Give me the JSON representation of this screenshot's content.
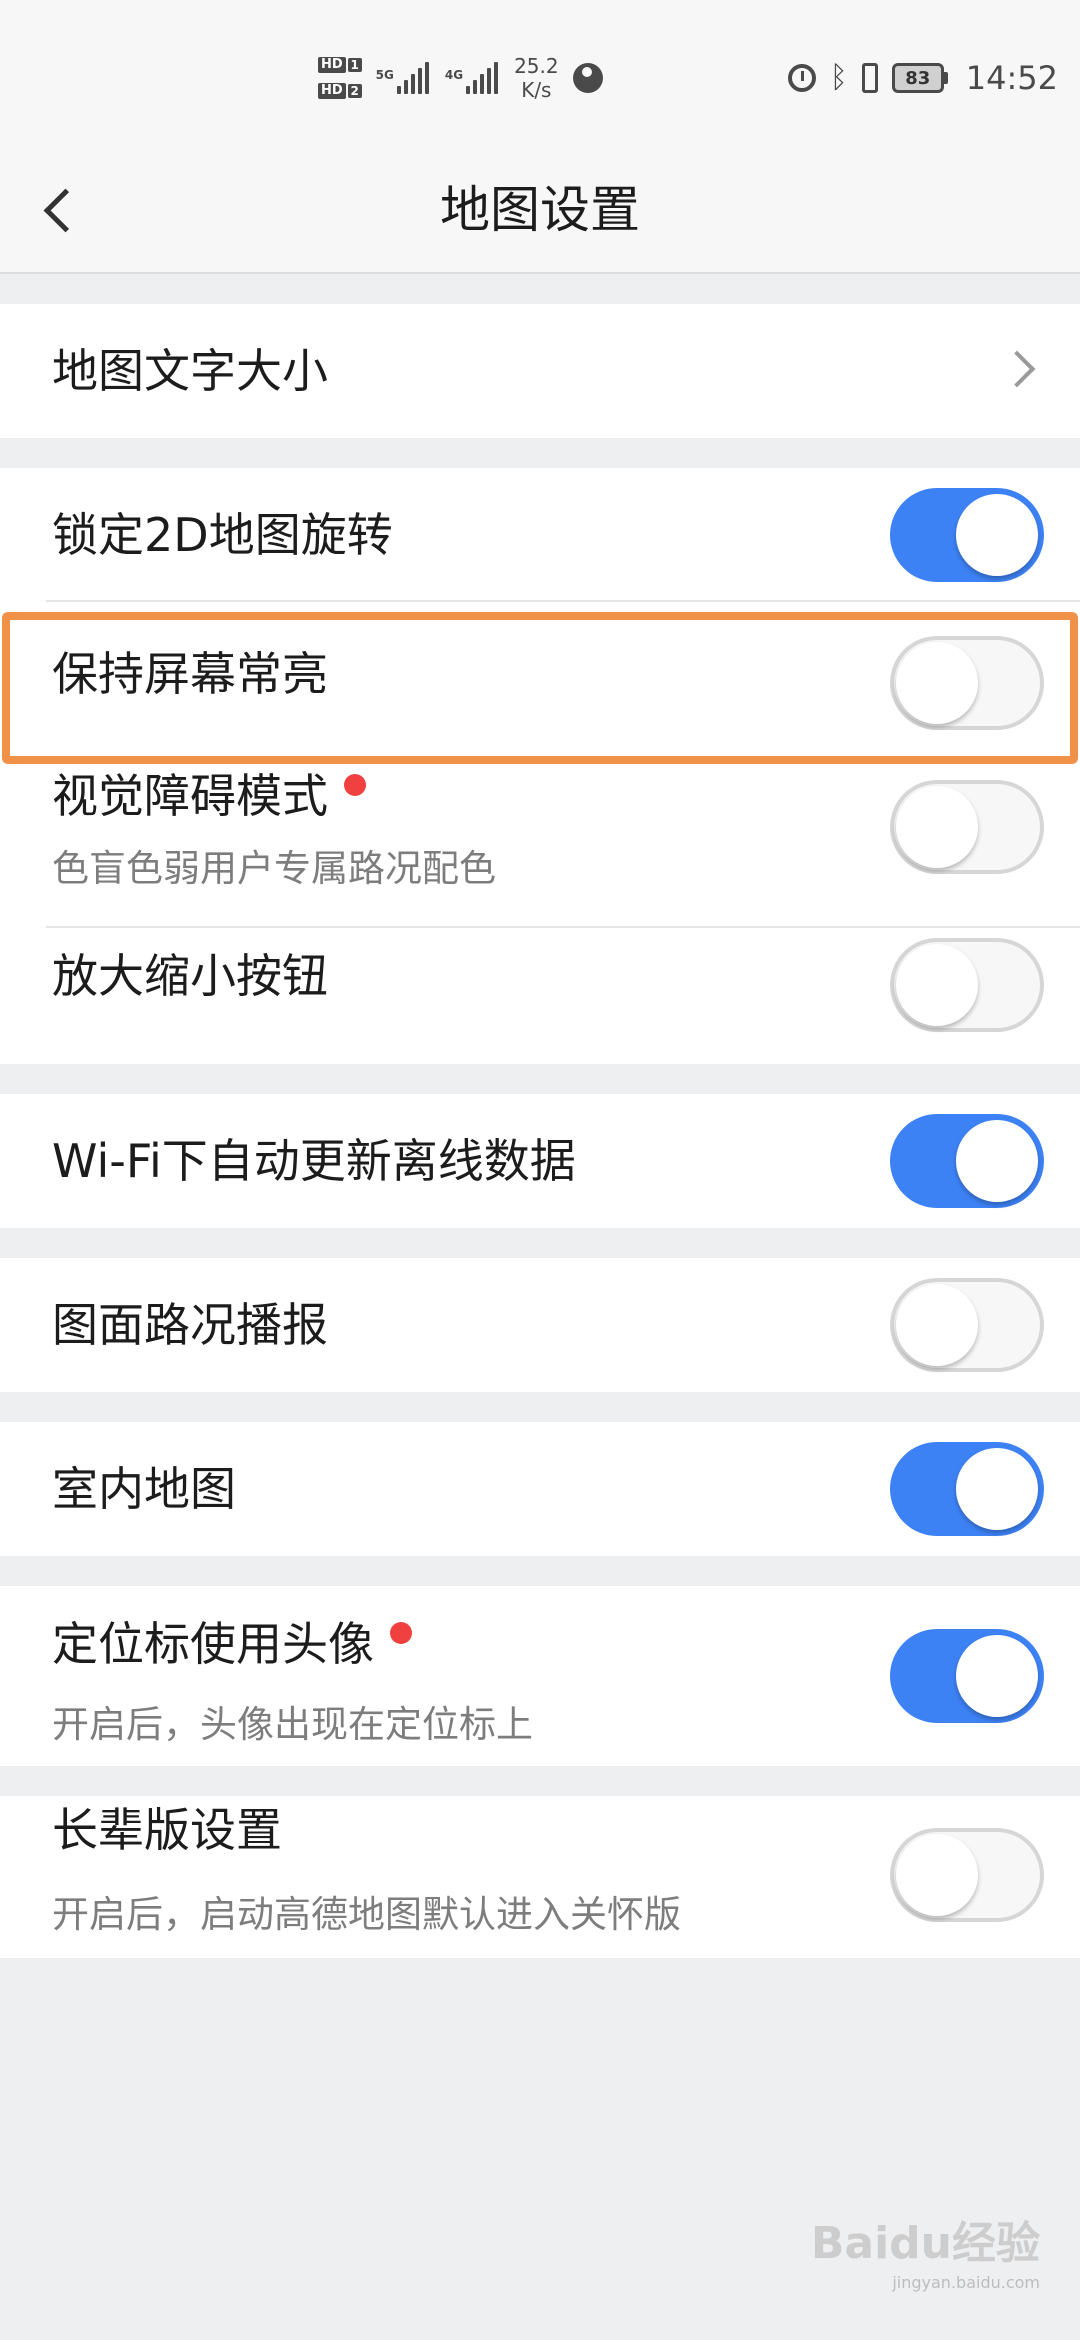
{
  "status_bar": {
    "hd1": "HD",
    "hd1_num": "1",
    "hd2": "HD",
    "hd2_num": "2",
    "net1": "5G",
    "net2": "4G",
    "speed_value": "25.2",
    "speed_unit": "K/s",
    "battery_level": "83",
    "time": "14:52",
    "icons": [
      "sim-hd-icon",
      "signal-5g-icon",
      "signal-4g-icon",
      "network-activity-icon",
      "alarm-icon",
      "bluetooth-icon",
      "vibrate-icon",
      "battery-icon"
    ]
  },
  "nav": {
    "back_icon": "chevron-left-icon",
    "title": "地图设置"
  },
  "settings": {
    "map_text_size": {
      "label": "地图文字大小",
      "icon": "chevron-right-icon"
    },
    "lock_2d_rotation": {
      "label": "锁定2D地图旋转",
      "enabled": true
    },
    "keep_screen_on": {
      "label": "保持屏幕常亮",
      "enabled": false,
      "highlighted": true
    },
    "visual_impairment_mode": {
      "label": "视觉障碍模式",
      "desc": "色盲色弱用户专属路况配色",
      "enabled": false,
      "new_badge": true
    },
    "zoom_buttons": {
      "label": "放大缩小按钮",
      "enabled": false
    },
    "wifi_auto_update": {
      "label": "Wi-Fi下自动更新离线数据",
      "enabled": true
    },
    "traffic_broadcast": {
      "label": "图面路况播报",
      "enabled": false
    },
    "indoor_map": {
      "label": "室内地图",
      "enabled": true
    },
    "avatar_as_locator": {
      "label": "定位标使用头像",
      "desc": "开启后，头像出现在定位标上",
      "enabled": true,
      "new_badge": true
    },
    "elder_mode": {
      "label": "长辈版设置",
      "desc": "开启后，启动高德地图默认进入关怀版",
      "enabled": false
    }
  },
  "colors": {
    "toggle_on": "#3d82f5",
    "highlight": "#f0914a",
    "badge": "#f04040"
  },
  "watermark": {
    "main": "Baidu经验",
    "sub": "jingyan.baidu.com"
  }
}
